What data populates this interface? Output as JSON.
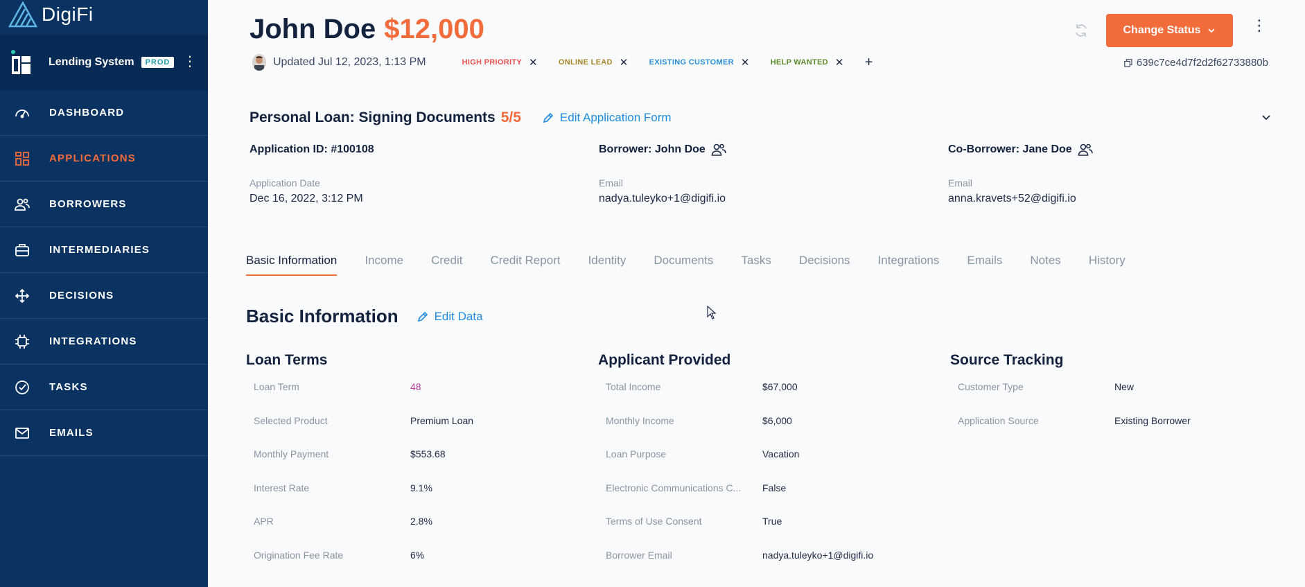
{
  "brand": {
    "name": "DigiFi"
  },
  "org": {
    "name": "Lending System",
    "env_badge": "PROD"
  },
  "sidebar": {
    "items": [
      {
        "label": "DASHBOARD",
        "icon": "dashboard-icon",
        "active": false
      },
      {
        "label": "APPLICATIONS",
        "icon": "applications-grid-icon",
        "active": true
      },
      {
        "label": "BORROWERS",
        "icon": "borrowers-icon",
        "active": false
      },
      {
        "label": "INTERMEDIARIES",
        "icon": "briefcase-icon",
        "active": false
      },
      {
        "label": "DECISIONS",
        "icon": "decisions-icon",
        "active": false
      },
      {
        "label": "INTEGRATIONS",
        "icon": "chip-icon",
        "active": false
      },
      {
        "label": "TASKS",
        "icon": "check-circle-icon",
        "active": false
      },
      {
        "label": "EMAILS",
        "icon": "envelope-icon",
        "active": false
      }
    ]
  },
  "header": {
    "name": "John Doe",
    "amount": "$12,000",
    "updated": "Updated Jul 12, 2023, 1:13 PM",
    "change_status_label": "Change Status",
    "application_hash": "639c7ce4d7f2d2f62733880b",
    "tags": [
      {
        "label": "HIGH PRIORITY",
        "color": "#e8504f"
      },
      {
        "label": "ONLINE LEAD",
        "color": "#a8862a"
      },
      {
        "label": "EXISTING CUSTOMER",
        "color": "#2d8fd5"
      },
      {
        "label": "HELP WANTED",
        "color": "#5c8a2a"
      }
    ]
  },
  "application": {
    "product_title": "Personal Loan: Signing Documents",
    "step": "5/5",
    "edit_form_label": "Edit Application Form",
    "columns": [
      {
        "head": "Application ID:  #100108",
        "label": "Application Date",
        "value": "Dec 16, 2022, 3:12 PM",
        "icon": false
      },
      {
        "head": "Borrower:  John Doe",
        "label": "Email",
        "value": "nadya.tuleyko+1@digifi.io",
        "icon": true
      },
      {
        "head": "Co-Borrower:  Jane Doe",
        "label": "Email",
        "value": "anna.kravets+52@digifi.io",
        "icon": true
      }
    ]
  },
  "tabs": [
    {
      "label": "Basic Information",
      "active": true
    },
    {
      "label": "Income",
      "active": false
    },
    {
      "label": "Credit",
      "active": false
    },
    {
      "label": "Credit Report",
      "active": false
    },
    {
      "label": "Identity",
      "active": false
    },
    {
      "label": "Documents",
      "active": false
    },
    {
      "label": "Tasks",
      "active": false
    },
    {
      "label": "Decisions",
      "active": false
    },
    {
      "label": "Integrations",
      "active": false
    },
    {
      "label": "Emails",
      "active": false
    },
    {
      "label": "Notes",
      "active": false
    },
    {
      "label": "History",
      "active": false
    }
  ],
  "section": {
    "title": "Basic Information",
    "edit_label": "Edit Data",
    "groups": [
      {
        "title": "Loan Terms",
        "rows": [
          {
            "k": "Loan Term",
            "v": "48",
            "highlight": true
          },
          {
            "k": "Selected Product",
            "v": "Premium Loan"
          },
          {
            "k": "Monthly Payment",
            "v": "$553.68"
          },
          {
            "k": "Interest Rate",
            "v": "9.1%"
          },
          {
            "k": "APR",
            "v": "2.8%"
          },
          {
            "k": "Origination Fee Rate",
            "v": "6%"
          }
        ]
      },
      {
        "title": "Applicant Provided",
        "rows": [
          {
            "k": "Total Income",
            "v": "$67,000"
          },
          {
            "k": "Monthly Income",
            "v": "$6,000"
          },
          {
            "k": "Loan Purpose",
            "v": "Vacation"
          },
          {
            "k": "Electronic Communications C...",
            "v": "False"
          },
          {
            "k": "Terms of Use Consent",
            "v": "True"
          },
          {
            "k": "Borrower Email",
            "v": "nadya.tuleyko+1@digifi.io"
          }
        ]
      },
      {
        "title": "Source Tracking",
        "rows": [
          {
            "k": "Customer Type",
            "v": "New"
          },
          {
            "k": "Application Source",
            "v": "Existing Borrower"
          }
        ]
      }
    ]
  }
}
